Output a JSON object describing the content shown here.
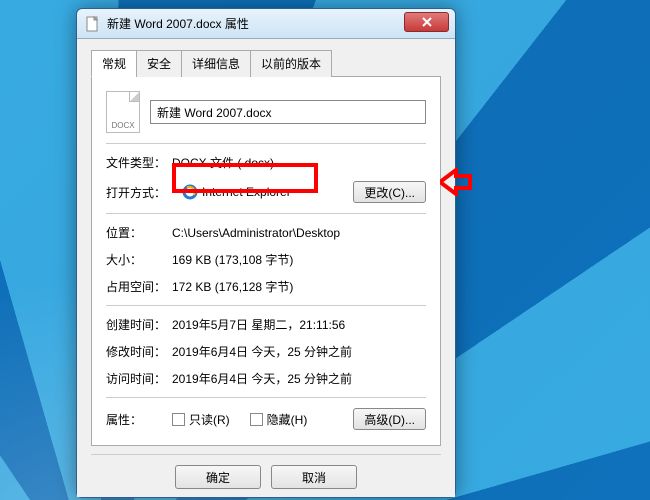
{
  "window": {
    "title": "新建 Word 2007.docx 属性"
  },
  "tabs": {
    "general": "常规",
    "security": "安全",
    "details": "详细信息",
    "previous": "以前的版本"
  },
  "file": {
    "icon_ext": "DOCX",
    "name": "新建 Word 2007.docx"
  },
  "labels": {
    "filetype": "文件类型：",
    "openwith": "打开方式：",
    "location": "位置：",
    "size": "大小：",
    "size_on_disk": "占用空间：",
    "created": "创建时间：",
    "modified": "修改时间：",
    "accessed": "访问时间：",
    "attributes": "属性："
  },
  "values": {
    "filetype": "DOCX 文件 (.docx)",
    "openwith_app": "Internet Explorer",
    "location": "C:\\Users\\Administrator\\Desktop",
    "size": "169 KB (173,108 字节)",
    "size_on_disk": "172 KB (176,128 字节)",
    "created": "2019年5月7日 星期二，21:11:56",
    "modified": "2019年6月4日 今天，25 分钟之前",
    "accessed": "2019年6月4日 今天，25 分钟之前"
  },
  "buttons": {
    "change": "更改(C)...",
    "advanced": "高级(D)...",
    "ok": "确定",
    "cancel": "取消"
  },
  "checkboxes": {
    "readonly": "只读(R)",
    "hidden": "隐藏(H)"
  },
  "colors": {
    "annotation": "#ff0000"
  }
}
